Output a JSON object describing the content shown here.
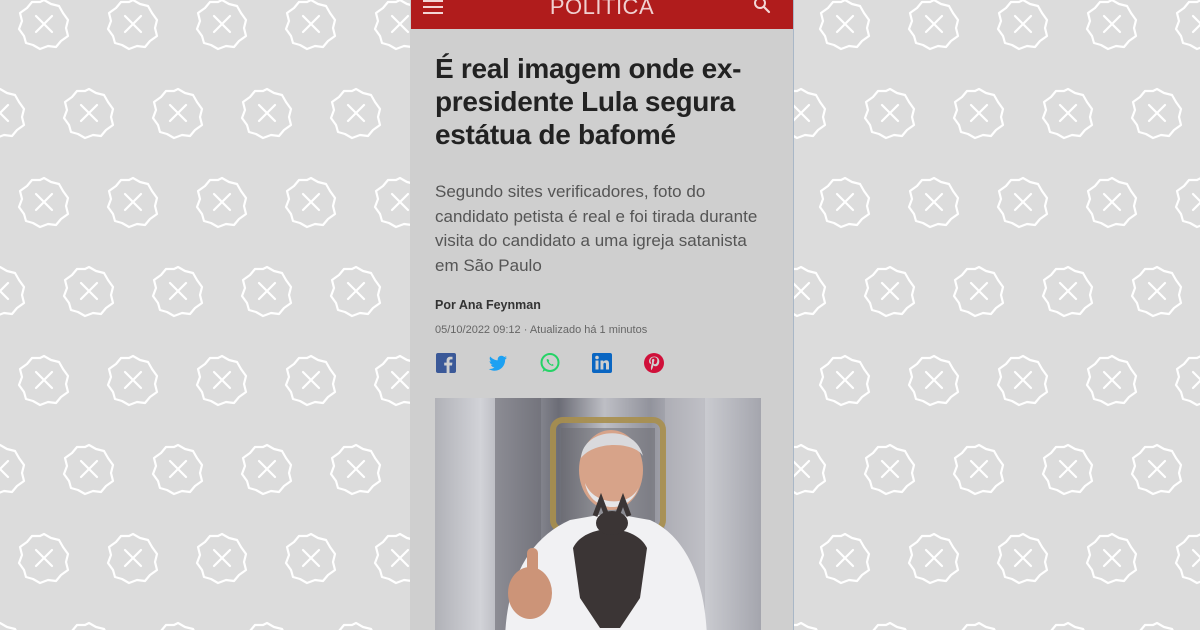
{
  "header": {
    "section": "POLITICA",
    "menu_icon": "hamburger-menu-icon",
    "search_icon": "search-icon",
    "color": "#b01c1c"
  },
  "article": {
    "headline": "É real imagem onde ex-presidente Lula segura estátua de bafomé",
    "subheadline": "Segundo sites verificadores, foto do candidato petista é real e foi tirada durante visita do candidato a uma igreja satanista em São Paulo",
    "byline_prefix": "Por",
    "author": "Ana Feynman",
    "date": "05/10/2022 09:12",
    "updated": "· Atualizado há 1 minutos"
  },
  "share": [
    {
      "icon": "facebook-icon",
      "color": "#3b5998"
    },
    {
      "icon": "twitter-icon",
      "color": "#1da1f2"
    },
    {
      "icon": "whatsapp-icon",
      "color": "#25d366"
    },
    {
      "icon": "linkedin-icon",
      "color": "#0a66c2"
    },
    {
      "icon": "pinterest-icon",
      "color": "#d0103a"
    }
  ],
  "watermark_icon": "x-circle-badge-icon"
}
